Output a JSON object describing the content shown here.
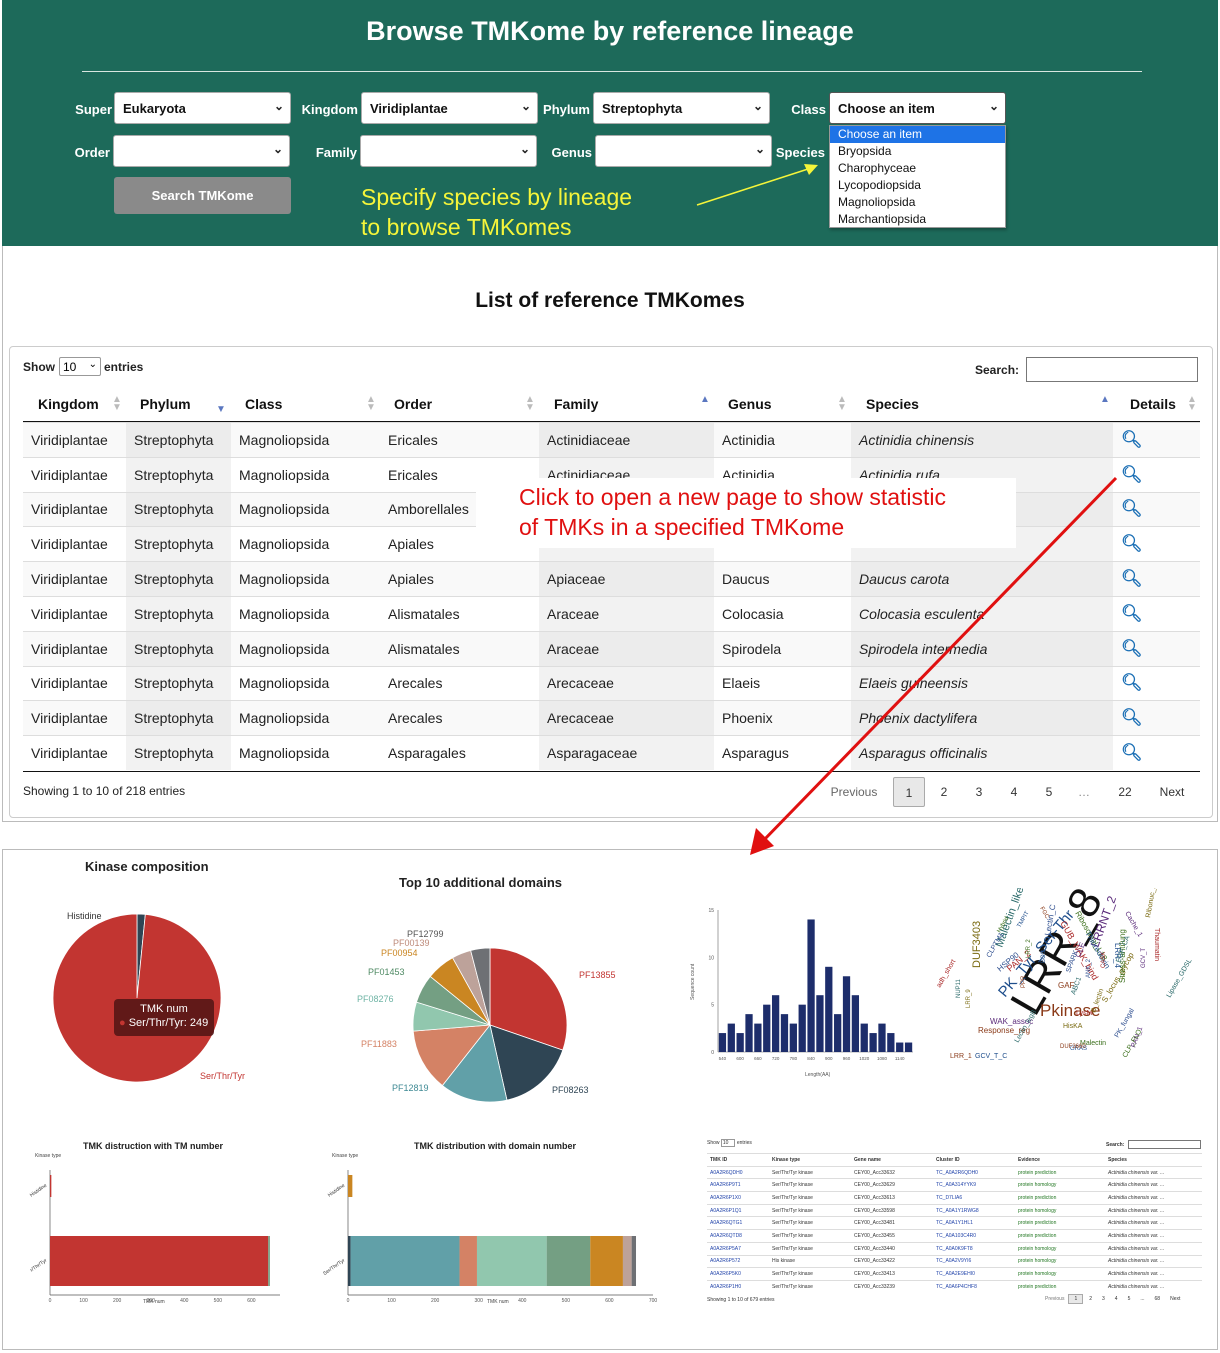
{
  "header": {
    "title": "Browse TMKome by reference lineage",
    "filters": [
      {
        "label": "Super",
        "value": "Eukaryota"
      },
      {
        "label": "Kingdom",
        "value": "Viridiplantae"
      },
      {
        "label": "Phylum",
        "value": "Streptophyta"
      },
      {
        "label": "Class",
        "value": "Choose an item"
      },
      {
        "label": "Order",
        "value": ""
      },
      {
        "label": "Family",
        "value": ""
      },
      {
        "label": "Genus",
        "value": ""
      },
      {
        "label": "Species",
        "value": ""
      }
    ],
    "search_button": "Search TMKome",
    "class_options": [
      "Choose an item",
      "Bryopsida",
      "Charophyceae",
      "Lycopodiopsida",
      "Magnoliopsida",
      "Marchantiopsida"
    ],
    "annotation": [
      "Specify species by lineage",
      "to browse TMKomes"
    ]
  },
  "list": {
    "title": "List of reference TMKomes",
    "show_label": "Show",
    "show_value": "10",
    "entries_label": "entries",
    "search_label": "Search:",
    "columns": [
      "Kingdom",
      "Phylum",
      "Class",
      "Order",
      "Family",
      "Genus",
      "Species",
      "Details"
    ],
    "rows": [
      [
        "Viridiplantae",
        "Streptophyta",
        "Magnoliopsida",
        "Ericales",
        "Actinidiaceae",
        "Actinidia",
        "Actinidia chinensis"
      ],
      [
        "Viridiplantae",
        "Streptophyta",
        "Magnoliopsida",
        "Ericales",
        "Actinidiaceae",
        "Actinidia",
        "Actinidia rufa"
      ],
      [
        "Viridiplantae",
        "Streptophyta",
        "Magnoliopsida",
        "Amborellales",
        "",
        "",
        ""
      ],
      [
        "Viridiplantae",
        "Streptophyta",
        "Magnoliopsida",
        "Apiales",
        "",
        "",
        ""
      ],
      [
        "Viridiplantae",
        "Streptophyta",
        "Magnoliopsida",
        "Apiales",
        "Apiaceae",
        "Daucus",
        "Daucus carota"
      ],
      [
        "Viridiplantae",
        "Streptophyta",
        "Magnoliopsida",
        "Alismatales",
        "Araceae",
        "Colocasia",
        "Colocasia esculenta"
      ],
      [
        "Viridiplantae",
        "Streptophyta",
        "Magnoliopsida",
        "Alismatales",
        "Araceae",
        "Spirodela",
        "Spirodela intermedia"
      ],
      [
        "Viridiplantae",
        "Streptophyta",
        "Magnoliopsida",
        "Arecales",
        "Arecaceae",
        "Elaeis",
        "Elaeis guineensis"
      ],
      [
        "Viridiplantae",
        "Streptophyta",
        "Magnoliopsida",
        "Arecales",
        "Arecaceae",
        "Phoenix",
        "Phoenix dactylifera"
      ],
      [
        "Viridiplantae",
        "Streptophyta",
        "Magnoliopsida",
        "Asparagales",
        "Asparagaceae",
        "Asparagus",
        "Asparagus officinalis"
      ]
    ],
    "info": "Showing 1 to 10 of 218 entries",
    "pagination": [
      "Previous",
      "1",
      "2",
      "3",
      "4",
      "5",
      "…",
      "22",
      "Next"
    ],
    "annotation": [
      "Click to open a new page to show statistic",
      "of TMKs in a specified TMKome"
    ]
  },
  "stats": {
    "kinase_title": "Kinase composition",
    "kinase_labels": [
      "Histidine",
      "Ser/Thr/Tyr"
    ],
    "tooltip_title": "TMK num",
    "tooltip_value": "Ser/Thr/Tyr: 249",
    "domains_title": "Top 10 additional domains",
    "domain_labels": [
      "PF12799",
      "PF00139",
      "PF00954",
      "PF01453",
      "PF08276",
      "PF11883",
      "PF12819",
      "PF08263",
      "PF13855"
    ],
    "tm_title": "TMK distruction with TM number",
    "dn_title": "TMK distribution with domain number",
    "kinase_type_label": "Kinase type",
    "tmk_num_label": "TMK num",
    "bar_y_labels": [
      "Histidine",
      "r/Thr/Tyr"
    ],
    "bar_y_labels2": [
      "Histidine",
      "Ser/Thr/Tyr"
    ],
    "bar_x_ticks": [
      "0",
      "100",
      "200",
      "300",
      "400",
      "500",
      "600",
      "700"
    ],
    "hist_ylabel": "Sequence count",
    "hist_xlabel": "Length(AA)",
    "words": [
      "LRR_8",
      "PK_Tyr_Ser-Thr",
      "Pkinase",
      "LRRNT_2",
      "Malectin_like",
      "DUF3403",
      "GUB_WAK_bind",
      "Lectin_C",
      "Ribosomal_L18",
      "Thioredoxin",
      "Response_reg",
      "WAK_assoc",
      "Lectin_legB",
      "S_locus_glycop",
      "PAN_2",
      "HSP90",
      "Stress-antifung",
      "LRR_4",
      "GAF",
      "CLE",
      "ABC1",
      "HisKA",
      "LysM",
      "SPARK",
      "Malectin",
      "GRAS",
      "DUF3660",
      "PAN_1",
      "Lipase_GDSL",
      "Ribonuc_2-5A",
      "Thaumatin",
      "PK_fungal",
      "CLP_FLO",
      "GCV_T_C",
      "LRR_1",
      "Cache_1",
      "EGF_CA",
      "B_lectin",
      "adh_short",
      "CLPTM1",
      "Hybrid",
      "TMPIT",
      "FGC",
      "GCV_T",
      "NUP11",
      "LRR_9",
      "CASK",
      "ANK_2",
      "LRR_2",
      "BOS",
      "PPR"
    ],
    "mini_table": {
      "show": "Show",
      "show_value": "10",
      "entries": "entries",
      "search": "Search:",
      "columns": [
        "TMK ID",
        "Kinase type",
        "Gene name",
        "Cluster ID",
        "Evidence",
        "Species"
      ],
      "rows": [
        [
          "A0A2R6QDH0",
          "Ser/Thr/Tyr kinase",
          "CEY00_Acc33632",
          "TC_A0A2R6QDH0",
          "protein prediction",
          "Actinidia chinensis var. ..."
        ],
        [
          "A0A2R6P9T1",
          "Ser/Thr/Tyr kinase",
          "CEY00_Acc33629",
          "TC_A0A314YYK9",
          "protein homology",
          "Actinidia chinensis var. ..."
        ],
        [
          "A0A2R6P1X0",
          "Ser/Thr/Tyr kinase",
          "CEY00_Acc33613",
          "TC_D7LIA6",
          "protein prediction",
          "Actinidia chinensis var. ..."
        ],
        [
          "A0A2R6P1Q1",
          "Ser/Thr/Tyr kinase",
          "CEY00_Acc33598",
          "TC_A0A1Y1RWG8",
          "protein homology",
          "Actinidia chinensis var. ..."
        ],
        [
          "A0A2R6QTG1",
          "Ser/Thr/Tyr kinase",
          "CEY00_Acc33481",
          "TC_A0A1Y1HL1",
          "protein prediction",
          "Actinidia chinensis var. ..."
        ],
        [
          "A0A2R6QTD8",
          "Ser/Thr/Tyr kinase",
          "CEY00_Acc33455",
          "TC_A0A103C4R0",
          "protein prediction",
          "Actinidia chinensis var. ..."
        ],
        [
          "A0A2R6P5A7",
          "Ser/Thr/Tyr kinase",
          "CEY00_Acc33440",
          "TC_A0A0K9FT8",
          "protein homology",
          "Actinidia chinensis var. ..."
        ],
        [
          "A0A2R6P572",
          "His kinase",
          "CEY00_Acc33422",
          "TC_A0A2V9YI6",
          "protein homology",
          "Actinidia chinensis var. ..."
        ],
        [
          "A0A2R6P5K0",
          "Ser/Thr/Tyr kinase",
          "CEY00_Acc33413",
          "TC_A0A2E9EHI0",
          "protein homology",
          "Actinidia chinensis var. ..."
        ],
        [
          "A0A2R6P1H0",
          "Ser/Thr/Tyr kinase",
          "CEY00_Acc33239",
          "TC_A0A6P4CHF8",
          "protein prediction",
          "Actinidia chinensis var. ..."
        ]
      ],
      "info": "Showing 1 to 10 of 679 entries",
      "pagination": [
        "Previous",
        "1",
        "2",
        "3",
        "4",
        "5",
        "...",
        "68",
        "Next"
      ]
    }
  },
  "chart_data": [
    {
      "type": "pie",
      "title": "Kinase composition",
      "categories": [
        "Histidine",
        "Ser/Thr/Tyr"
      ],
      "values": [
        4,
        249
      ],
      "colors": [
        "#2f4554",
        "#c23531"
      ]
    },
    {
      "type": "pie",
      "title": "Top 10 additional domains",
      "categories": [
        "PF13855",
        "PF08263",
        "PF12819",
        "PF11883",
        "PF08276",
        "PF01453",
        "PF00954",
        "PF00139",
        "PF12799"
      ],
      "values": [
        30,
        16,
        14,
        13,
        6,
        6,
        6,
        4,
        4
      ],
      "colors": [
        "#c23531",
        "#2f4554",
        "#61a0a8",
        "#d48265",
        "#91c7ae",
        "#749f83",
        "#ca8622",
        "#bda29a",
        "#6e7074"
      ]
    },
    {
      "type": "bar",
      "title": "TMK distruction with TM number",
      "categories": [
        "Histidine",
        "r/Thr/Tyr"
      ],
      "series": [
        {
          "values": [
            4,
            650
          ]
        },
        {
          "values": [
            0,
            5
          ]
        }
      ],
      "xlim": [
        0,
        700
      ],
      "xlabel": "TMK num",
      "ylabel": "Kinase type",
      "colors": [
        "#c23531",
        "#749f83"
      ]
    },
    {
      "type": "bar",
      "title": "TMK distribution with domain number",
      "categories": [
        "Histidine",
        "Ser/Thr/Tyr"
      ],
      "series": [
        {
          "values": [
            0,
            6
          ]
        },
        {
          "values": [
            0,
            250
          ]
        },
        {
          "values": [
            0,
            40
          ]
        },
        {
          "values": [
            0,
            160
          ]
        },
        {
          "values": [
            0,
            100
          ]
        },
        {
          "values": [
            10,
            75
          ]
        },
        {
          "values": [
            0,
            20
          ]
        },
        {
          "values": [
            0,
            10
          ]
        }
      ],
      "xlim": [
        0,
        700
      ],
      "xlabel": "TMK num",
      "ylabel": "Kinase type",
      "colors": [
        "#2f4554",
        "#61a0a8",
        "#d48265",
        "#91c7ae",
        "#749f83",
        "#ca8622",
        "#bda29a",
        "#6e7074"
      ]
    },
    {
      "type": "bar",
      "title": "",
      "xlabel": "Length(AA)",
      "ylabel": "Sequence count",
      "ylim": [
        0,
        15
      ],
      "x": [
        540,
        570,
        600,
        630,
        660,
        690,
        720,
        750,
        780,
        810,
        840,
        870,
        900,
        930,
        960,
        990,
        1020,
        1050,
        1080,
        1110,
        1140,
        1170
      ],
      "values": [
        2,
        3,
        2,
        4,
        3,
        5,
        6,
        4,
        3,
        5,
        14,
        6,
        9,
        4,
        8,
        6,
        3,
        2,
        3,
        2,
        1,
        1
      ]
    }
  ],
  "colors": {
    "header_bg": "#1d6a5a",
    "annotation_yellow": "#f5f53a",
    "annotation_red": "#e01010",
    "link_blue": "#1b6fb5"
  }
}
